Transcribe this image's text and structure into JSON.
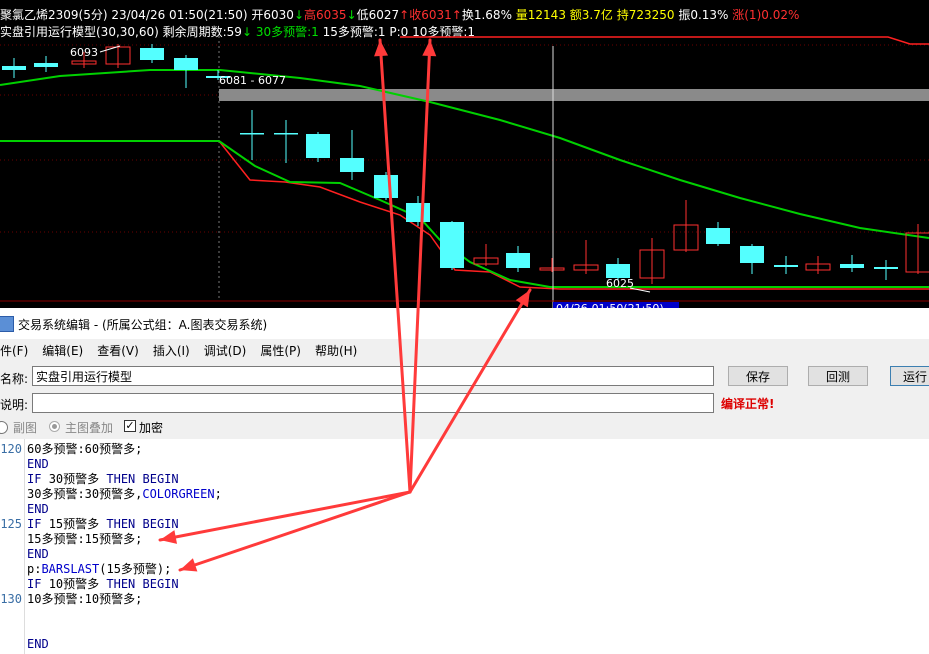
{
  "chart": {
    "header_line1": [
      {
        "text": "聚氯乙烯2309(5分) 23/04/26 01:50(21:50) 开6030",
        "color": "#ffffff"
      },
      {
        "text": "↓",
        "color": "#00e000"
      },
      {
        "text": "高6035",
        "color": "#ff3030"
      },
      {
        "text": "↓",
        "color": "#00e000"
      },
      {
        "text": "低6027",
        "color": "#ffffff"
      },
      {
        "text": "↑",
        "color": "#ff3030"
      },
      {
        "text": "收6031",
        "color": "#ff3030"
      },
      {
        "text": "↑",
        "color": "#ff3030"
      },
      {
        "text": "换1.68% ",
        "color": "#ffffff"
      },
      {
        "text": "量12143 ",
        "color": "#ffff00"
      },
      {
        "text": "额3.7亿 ",
        "color": "#ffff00"
      },
      {
        "text": "持723250 ",
        "color": "#ffff00"
      },
      {
        "text": "振0.13% ",
        "color": "#ffffff"
      },
      {
        "text": "涨(1)0.02%",
        "color": "#ff3030"
      }
    ],
    "header_line2": [
      {
        "text": "实盘引用运行模型(30,30,60) 剩余周期数:59",
        "color": "#ffffff"
      },
      {
        "text": "↓",
        "color": "#00e000"
      },
      {
        "text": " 30多预警:1 ",
        "color": "#00e000"
      },
      {
        "text": "15多预警:1 P:0 10多预警:1",
        "color": "#ffffff"
      }
    ],
    "labels": {
      "high_price": "6093",
      "range_label": "6081 - 6077",
      "low_price": "6025",
      "cursor_time": "04/26-01:50(21:50)"
    },
    "colors": {
      "up": "#ff3030",
      "down": "#54ffff",
      "ma_green": "#00d000",
      "ma_red": "#ff2020",
      "band": "#8a8a8a",
      "arrow": "#ff3a3a"
    }
  },
  "editor": {
    "window_title": "交易系统编辑 - (所属公式组：A.图表交易系统)",
    "menu": [
      "件(F)",
      "编辑(E)",
      "查看(V)",
      "插入(I)",
      "调试(D)",
      "属性(P)",
      "帮助(H)"
    ],
    "name_label": "名称:",
    "name_value": "实盘引用运行模型",
    "desc_label": "说明:",
    "desc_value": "",
    "save_label": "保存",
    "backtest_label": "回测",
    "run_label": "运行",
    "status_text": "编译正常!",
    "opt_subchart": "副图",
    "opt_main_overlay": "主图叠加",
    "opt_encrypt": "加密",
    "line_numbers": [
      {
        "n": "120",
        "row": 0
      },
      {
        "n": "125",
        "row": 5
      },
      {
        "n": "130",
        "row": 10
      }
    ],
    "code_lines": [
      [
        {
          "t": "60多预警:60预警多;",
          "c": "#000"
        }
      ],
      [
        {
          "t": "END",
          "c": "#00008b"
        }
      ],
      [
        {
          "t": "IF ",
          "c": "#00008b"
        },
        {
          "t": "30预警多 ",
          "c": "#000"
        },
        {
          "t": "THEN BEGIN",
          "c": "#00008b"
        }
      ],
      [
        {
          "t": "30多预警:30预警多,",
          "c": "#000"
        },
        {
          "t": "COLORGREEN",
          "c": "#0000cc"
        },
        {
          "t": ";",
          "c": "#000"
        }
      ],
      [
        {
          "t": "END",
          "c": "#00008b"
        }
      ],
      [
        {
          "t": "IF ",
          "c": "#00008b"
        },
        {
          "t": "15预警多 ",
          "c": "#000"
        },
        {
          "t": "THEN BEGIN",
          "c": "#00008b"
        }
      ],
      [
        {
          "t": "15多预警:15预警多;",
          "c": "#000"
        }
      ],
      [
        {
          "t": "END",
          "c": "#00008b"
        }
      ],
      [
        {
          "t": "p:",
          "c": "#000"
        },
        {
          "t": "BARSLAST",
          "c": "#0000cc"
        },
        {
          "t": "(15多预警);",
          "c": "#000"
        }
      ],
      [
        {
          "t": "IF ",
          "c": "#00008b"
        },
        {
          "t": "10预警多 ",
          "c": "#000"
        },
        {
          "t": "THEN BEGIN",
          "c": "#00008b"
        }
      ],
      [
        {
          "t": "10多预警:10预警多;",
          "c": "#000"
        }
      ],
      [
        {
          "t": "",
          "c": "#000"
        }
      ],
      [
        {
          "t": "",
          "c": "#000"
        }
      ],
      [
        {
          "t": "END",
          "c": "#00008b"
        }
      ]
    ]
  }
}
